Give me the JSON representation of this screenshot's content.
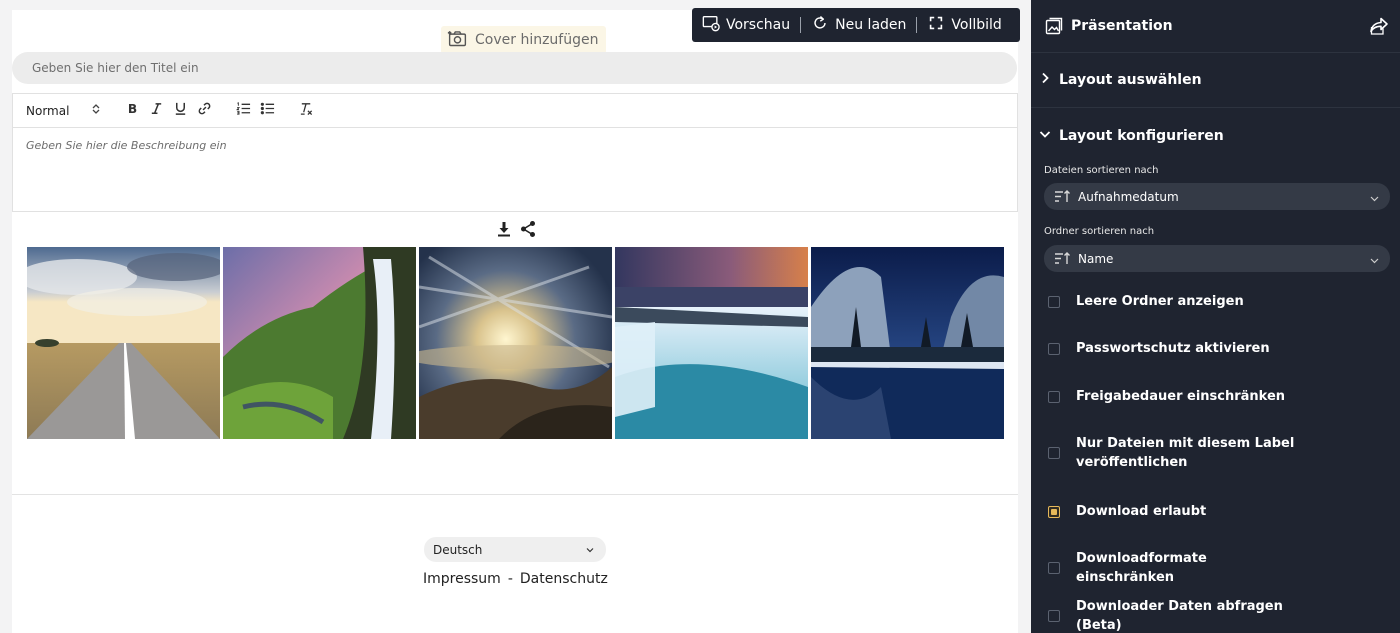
{
  "editor": {
    "cover_label": "Cover hinzufügen",
    "preview_bar": {
      "preview": "Vorschau",
      "reload": "Neu laden",
      "fullscreen": "Vollbild"
    },
    "title_placeholder": "Geben Sie hier den Titel ein",
    "toolbar": {
      "format": "Normal",
      "icons": [
        "bold-icon",
        "italic-icon",
        "underline-icon",
        "link-icon",
        "ordered-list-icon",
        "bullet-list-icon",
        "clear-format-icon"
      ]
    },
    "description_placeholder": "Geben Sie hier die Beschreibung ein",
    "gallery": {
      "actions": [
        "download-icon",
        "share-icon"
      ],
      "photos": [
        "road-photo",
        "waterfall-photo",
        "sky-photo",
        "falls-photo",
        "lake-photo"
      ]
    },
    "footer": {
      "language": "Deutsch",
      "imprint": "Impressum",
      "separator": "-",
      "privacy": "Datenschutz"
    }
  },
  "sidebar": {
    "title": "Präsentation",
    "sections": {
      "layout_select": "Layout auswählen",
      "layout_configure": "Layout konfigurieren"
    },
    "sort_files_label": "Dateien sortieren nach",
    "sort_files_value": "Aufnahmedatum",
    "sort_folders_label": "Ordner sortieren nach",
    "sort_folders_value": "Name",
    "options": [
      {
        "label": "Leere Ordner anzeigen",
        "checked": false
      },
      {
        "label": "Passwortschutz aktivieren",
        "checked": false
      },
      {
        "label": "Freigabedauer einschränken",
        "checked": false
      },
      {
        "label": "Nur Dateien mit diesem Label veröffentlichen",
        "checked": false
      },
      {
        "label": "Download erlaubt",
        "checked": true
      },
      {
        "label": "Downloadformate einschränken",
        "checked": false
      },
      {
        "label": "Downloader Daten abfragen (Beta)",
        "checked": false
      }
    ]
  },
  "colors": {
    "sidebar_bg": "#1f2430",
    "accent_checked": "#e6b85a",
    "cover_button_bg": "#fbf6e6"
  }
}
